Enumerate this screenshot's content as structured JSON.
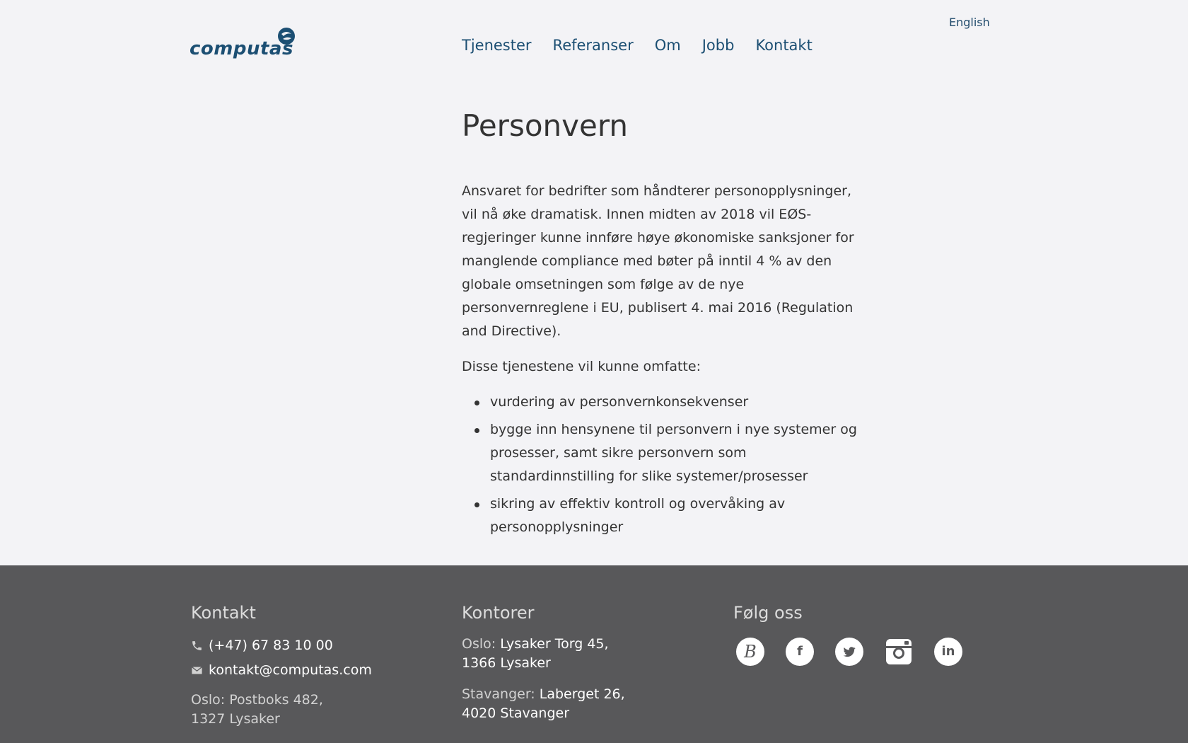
{
  "header": {
    "logo_text": "computas",
    "language_link": "English",
    "nav": [
      "Tjenester",
      "Referanser",
      "Om",
      "Jobb",
      "Kontakt"
    ]
  },
  "main": {
    "title": "Personvern",
    "intro": "Ansvaret for bedrifter som håndterer personopplysninger, vil nå øke dramatisk. Innen midten av 2018 vil EØS-regjeringer kunne innføre høye økonomiske sanksjoner for manglende compliance med bøter på inntil 4 % av den globale omsetningen som følge av de nye personvernreglene i EU, publisert 4. mai 2016 (Regulation and Directive).",
    "lead": "Disse tjenestene vil kunne omfatte:",
    "bullets": [
      "vurdering av personvernkonsekvenser",
      "bygge inn hensynene til personvern i nye systemer og prosesser, samt sikre personvern som standardinnstilling for slike systemer/prosesser",
      "sikring av effektiv kontroll og overvåking av personopplysninger"
    ]
  },
  "footer": {
    "contact": {
      "heading": "Kontakt",
      "phone": "(+47) 67 83 10 00",
      "email": "kontakt@computas.com",
      "postal_label": "Oslo: Postboks 482,",
      "postal_line2": "1327 Lysaker"
    },
    "offices": {
      "heading": "Kontorer",
      "items": [
        {
          "label": "Oslo:",
          "line1": "Lysaker Torg 45,",
          "line2": "1366 Lysaker"
        },
        {
          "label": "Stavanger:",
          "line1": "Laberget 26,",
          "line2": "4020 Stavanger"
        }
      ]
    },
    "follow": {
      "heading": "Følg oss",
      "icons": [
        "blog-icon",
        "facebook-icon",
        "twitter-icon",
        "instagram-icon",
        "linkedin-icon"
      ],
      "icon_glyphs": [
        "B",
        "f",
        "",
        "",
        "in"
      ]
    },
    "colors": {
      "background": "#58585a",
      "brand": "#1c4f73"
    }
  }
}
